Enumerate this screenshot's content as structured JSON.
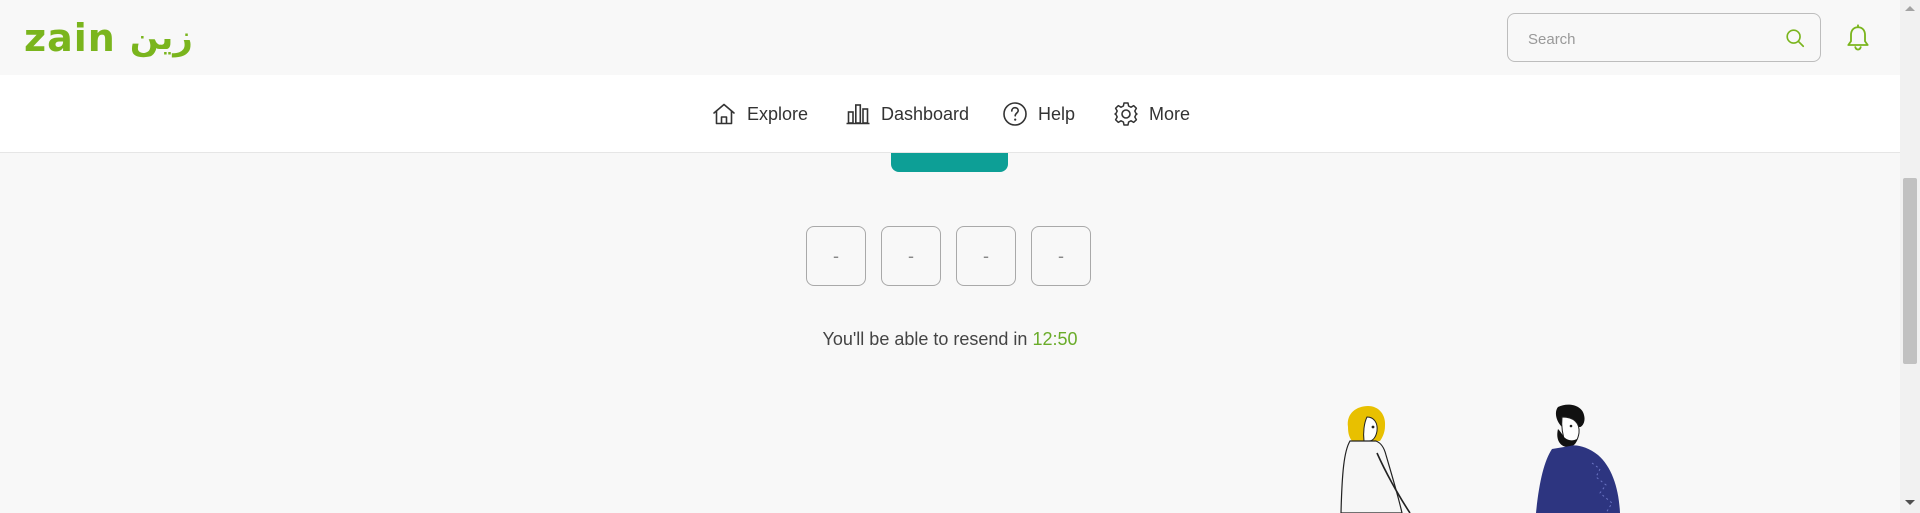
{
  "header": {
    "logo_text": "zain",
    "logo_arabic": "زين",
    "search": {
      "placeholder": "Search",
      "value": ""
    },
    "search_icon": "search-icon",
    "notification_icon": "bell-icon"
  },
  "nav": {
    "items": [
      {
        "label": "Explore",
        "icon": "home-icon"
      },
      {
        "label": "Dashboard",
        "icon": "bar-chart-icon"
      },
      {
        "label": "Help",
        "icon": "question-circle-icon"
      },
      {
        "label": "More",
        "icon": "gear-icon"
      }
    ]
  },
  "otp": {
    "digits": [
      "-",
      "-",
      "-",
      "-"
    ]
  },
  "resend": {
    "text": "You'll be able to resend in",
    "timer": "12:50"
  },
  "colors": {
    "brand_green": "#7ab51d",
    "timer_green": "#6aac2a",
    "teal": "#0d9f96",
    "illustration_yellow": "#e8c000",
    "illustration_navy": "#2d3580"
  }
}
